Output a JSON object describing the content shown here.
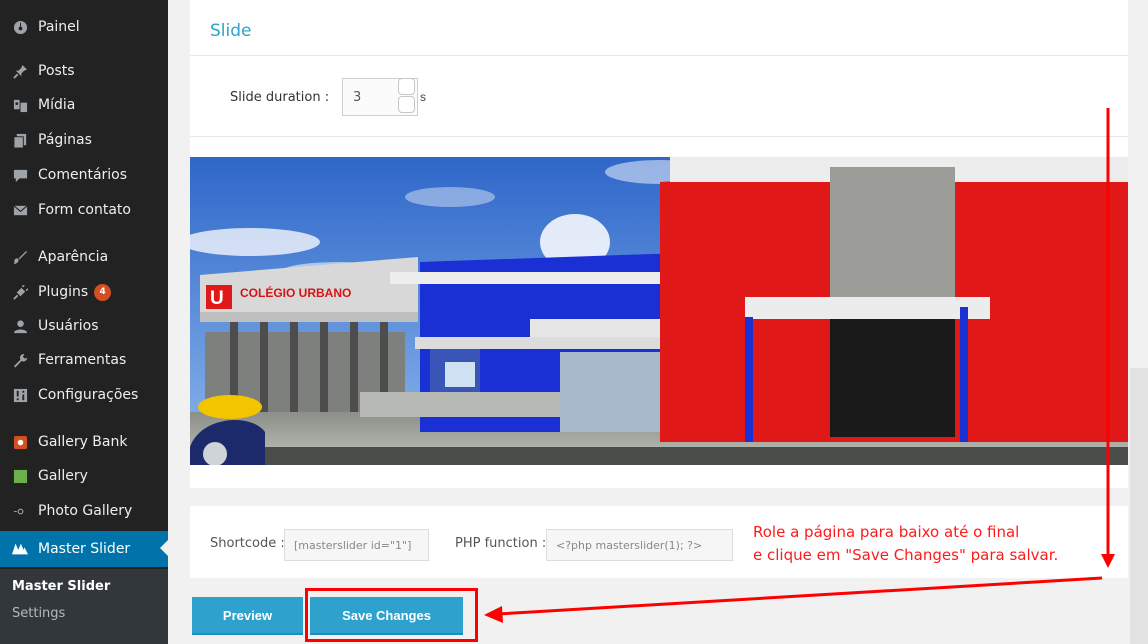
{
  "sidebar": {
    "items": [
      {
        "label": "Painel",
        "icon": "dashboard-icon"
      },
      {
        "label": "Posts",
        "icon": "pushpin-icon"
      },
      {
        "label": "Mídia",
        "icon": "media-icon"
      },
      {
        "label": "Páginas",
        "icon": "pages-icon"
      },
      {
        "label": "Comentários",
        "icon": "comment-icon"
      },
      {
        "label": "Form contato",
        "icon": "mail-icon"
      },
      {
        "label": "Aparência",
        "icon": "brush-icon"
      },
      {
        "label": "Plugins",
        "icon": "plugin-icon",
        "badge": "4"
      },
      {
        "label": "Usuários",
        "icon": "user-icon"
      },
      {
        "label": "Ferramentas",
        "icon": "wrench-icon"
      },
      {
        "label": "Configurações",
        "icon": "settings-icon"
      },
      {
        "label": "Gallery Bank",
        "icon": "gallery-bank-icon"
      },
      {
        "label": "Gallery",
        "icon": "gallery-icon"
      },
      {
        "label": "Photo Gallery",
        "icon": "photo-gallery-icon"
      },
      {
        "label": "Master Slider",
        "icon": "master-slider-icon",
        "active": true
      }
    ],
    "submenu": [
      {
        "label": "Master Slider",
        "current": true
      },
      {
        "label": "Settings"
      }
    ]
  },
  "slide_panel": {
    "title": "Slide",
    "duration_label": "Slide duration :",
    "duration_value": "3",
    "duration_unit": "s",
    "image_sign_text": "COLÉGIO URBANO",
    "image_logo_letter": "U"
  },
  "shortcode_panel": {
    "shortcode_label": "Shortcode :",
    "shortcode_value": "[masterslider id=\"1\"]",
    "php_label": "PHP function :",
    "php_value": "<?php masterslider(1); ?>"
  },
  "buttons": {
    "preview": "Preview",
    "save": "Save Changes"
  },
  "annotation": {
    "line1": "Role a página para baixo até o final",
    "line2": "e clique em \"Save Changes\" para salvar."
  },
  "colors": {
    "sidebar_bg": "#222222",
    "active_blue": "#0073aa",
    "button_blue": "#2ea2cc",
    "annotation_red": "#ff0000",
    "badge_orange": "#d54e21"
  }
}
